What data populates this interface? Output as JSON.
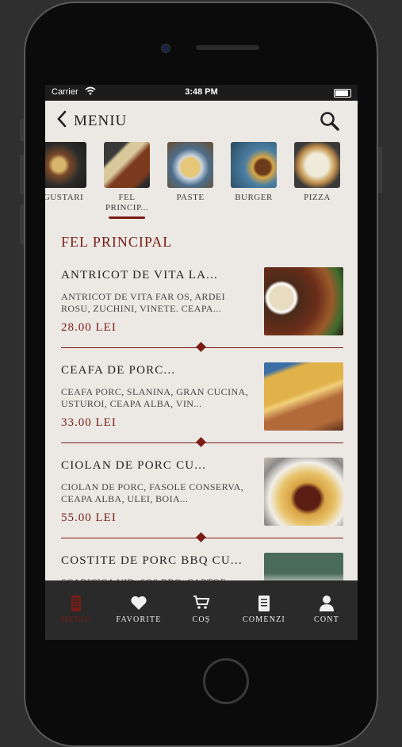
{
  "status": {
    "carrier": "Carrier",
    "time": "3:48 PM"
  },
  "nav": {
    "title": "MENIU"
  },
  "categories": [
    {
      "label": "GUSTARI",
      "active": false
    },
    {
      "label": "FEL PRINCIP...",
      "active": true
    },
    {
      "label": "PASTE",
      "active": false
    },
    {
      "label": "BURGER",
      "active": false
    },
    {
      "label": "PIZZA",
      "active": false
    }
  ],
  "section_title": "FEL PRINCIPAL",
  "items": [
    {
      "name": "ANTRICOT DE VITA LA...",
      "desc": "ANTRICOT DE VITA FAR OS, ARDEI ROSU, ZUCHINI, VINETE. CEAPA...",
      "price": "28.00 LEI"
    },
    {
      "name": "CEAFA DE PORC...",
      "desc": "CEAFA PORC, SLANINA, GRAN CUCINA, USTUROI, CEAPA ALBA, VIN...",
      "price": "33.00 LEI"
    },
    {
      "name": "CIOLAN DE PORC CU...",
      "desc": "CIOLAN DE PORC, FASOLE CONSERVA, CEAPA ALBA, ULEI, BOIA...",
      "price": "55.00 LEI"
    },
    {
      "name": "COSTITE DE PORC BBQ CU...",
      "desc": "SCARICICA VID, SOS BBQ, CARTOF...",
      "price": ""
    }
  ],
  "tabs": [
    {
      "label": "MENIU",
      "icon": "menu-phone-icon",
      "active": true
    },
    {
      "label": "FAVORITE",
      "icon": "heart-icon",
      "active": false
    },
    {
      "label": "COȘ",
      "icon": "cart-icon",
      "active": false
    },
    {
      "label": "COMENZI",
      "icon": "receipt-icon",
      "active": false
    },
    {
      "label": "CONT",
      "icon": "user-icon",
      "active": false
    }
  ],
  "colors": {
    "accent": "#7a1c14",
    "background": "#ece9e5",
    "tabbar": "#2a2a2a"
  }
}
